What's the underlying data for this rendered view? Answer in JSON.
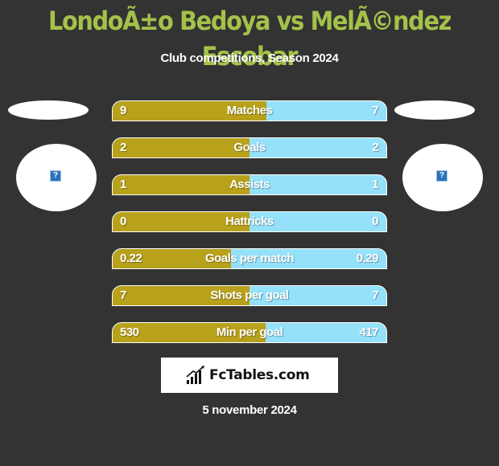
{
  "header": {
    "title": "LondoÃ±o Bedoya vs MelÃ©ndez Escobar",
    "subtitle": "Club competitions, Season 2024"
  },
  "players": {
    "left": {
      "logo_icon": "missing-image-icon",
      "logo_glyph": "?"
    },
    "right": {
      "logo_icon": "missing-image-icon",
      "logo_glyph": "?"
    }
  },
  "colors": {
    "left_bar": "#b8a11b",
    "right_bar": "#95e1fa",
    "title": "#a4c24a",
    "background": "#333333"
  },
  "stats": [
    {
      "label": "Matches",
      "left": "9",
      "right": "7",
      "left_share": 0.5625
    },
    {
      "label": "Goals",
      "left": "2",
      "right": "2",
      "left_share": 0.5
    },
    {
      "label": "Assists",
      "left": "1",
      "right": "1",
      "left_share": 0.5
    },
    {
      "label": "Hattricks",
      "left": "0",
      "right": "0",
      "left_share": 0.5
    },
    {
      "label": "Goals per match",
      "left": "0.22",
      "right": "0.29",
      "left_share": 0.4314
    },
    {
      "label": "Shots per goal",
      "left": "7",
      "right": "7",
      "left_share": 0.5
    },
    {
      "label": "Min per goal",
      "left": "530",
      "right": "417",
      "left_share": 0.5597
    }
  ],
  "footer": {
    "brand": "FcTables.com",
    "brand_icon": "bar-chart-icon",
    "date": "5 november 2024"
  }
}
